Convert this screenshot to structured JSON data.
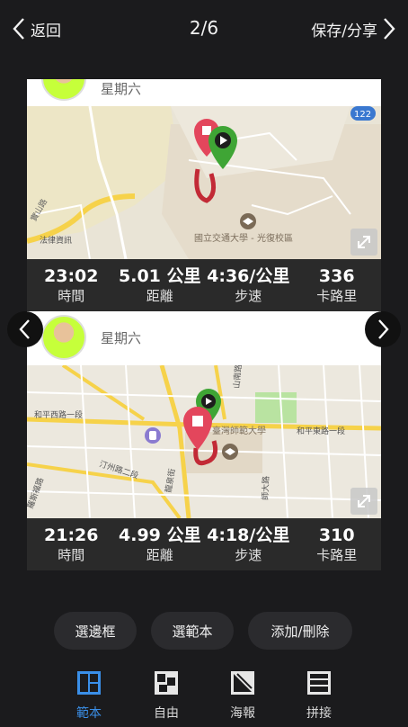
{
  "header": {
    "back_label": "返回",
    "counter": "2/6",
    "save_label": "保存/分享"
  },
  "cards": [
    {
      "day": "星期六",
      "place_label": "國立交通大學 - 光復校區",
      "badge": "122",
      "street_labels": [
        "實山路",
        "法律資訊"
      ],
      "stats": [
        {
          "value": "23:02",
          "label": "時間"
        },
        {
          "value": "5.01 公里",
          "label": "距離"
        },
        {
          "value": "4:36/公里",
          "label": "步速"
        },
        {
          "value": "336",
          "label": "卡路里"
        }
      ]
    },
    {
      "day": "星期六",
      "place_label": "臺灣師範大學",
      "street_labels": [
        "和平西路一段",
        "和平東路一段",
        "汀州路二段",
        "龍泉街",
        "師大路",
        "羅斯福路",
        "山南路"
      ],
      "stats": [
        {
          "value": "21:26",
          "label": "時間"
        },
        {
          "value": "4.99 公里",
          "label": "距離"
        },
        {
          "value": "4:18/公里",
          "label": "步速"
        },
        {
          "value": "310",
          "label": "卡路里"
        }
      ]
    }
  ],
  "actions": {
    "border": "選邊框",
    "template": "選範本",
    "add_remove": "添加/刪除"
  },
  "tabs": [
    {
      "label": "範本",
      "icon": "template-icon",
      "active": true
    },
    {
      "label": "自由",
      "icon": "freeform-icon",
      "active": false
    },
    {
      "label": "海報",
      "icon": "poster-icon",
      "active": false
    },
    {
      "label": "拼接",
      "icon": "stitch-icon",
      "active": false
    }
  ],
  "colors": {
    "background": "#1b1b1d",
    "accent": "#3a8fe8",
    "stats_bar": "#2a2a2a",
    "route": "#d0303a",
    "pin_start": "#3fa535",
    "pin_end": "#e3465c"
  }
}
